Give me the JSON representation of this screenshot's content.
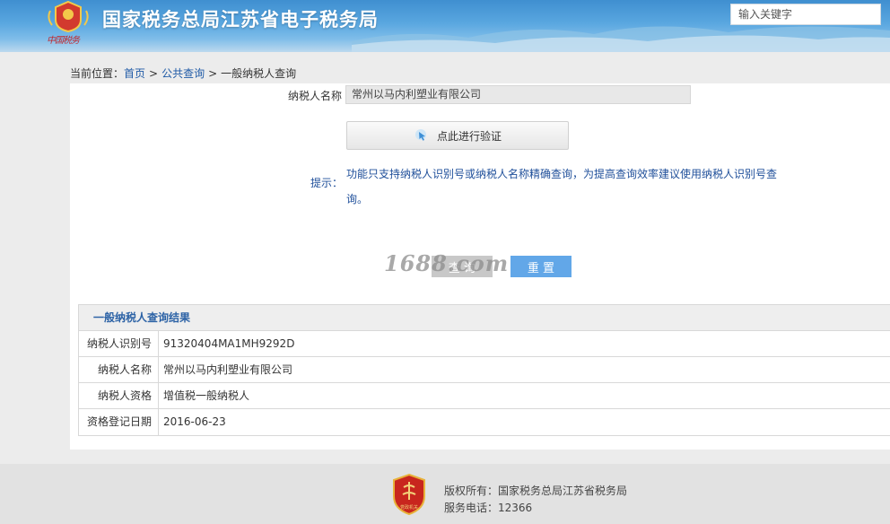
{
  "header": {
    "emblem_text": "中国税务",
    "site_title": "国家税务总局江苏省电子税务局",
    "search_placeholder": "输入关键字"
  },
  "breadcrumb": {
    "prefix": "当前位置：",
    "items": [
      "首页",
      "公共查询",
      "一般纳税人查询"
    ],
    "separator": ">"
  },
  "form": {
    "name_label": "纳税人名称",
    "name_value": "常州以马内利塑业有限公司",
    "verify_button": "点此进行验证",
    "hint_label": "提示：",
    "hint_text": "功能只支持纳税人识别号或纳税人名称精确查询，为提高查询效率建议使用纳税人识别号查询。",
    "query_button": "查 询",
    "reset_button": "重 置"
  },
  "watermark": "1688.com",
  "result": {
    "title": "一般纳税人查询结果",
    "rows": [
      {
        "key": "纳税人识别号",
        "value": "91320404MA1MH9292D"
      },
      {
        "key": "纳税人名称",
        "value": "常州以马内利塑业有限公司"
      },
      {
        "key": "纳税人资格",
        "value": "增值税一般纳税人"
      },
      {
        "key": "资格登记日期",
        "value": "2016-06-23"
      }
    ]
  },
  "footer": {
    "badge_text": "党政机关",
    "copyright": "版权所有：国家税务总局江苏省税务局",
    "phone": "服务电话：12366"
  },
  "colors": {
    "header_blue": "#4a9ad8",
    "link_blue": "#1f5aa6",
    "reset_button": "#62a7e8",
    "result_title": "#2d63a6"
  }
}
